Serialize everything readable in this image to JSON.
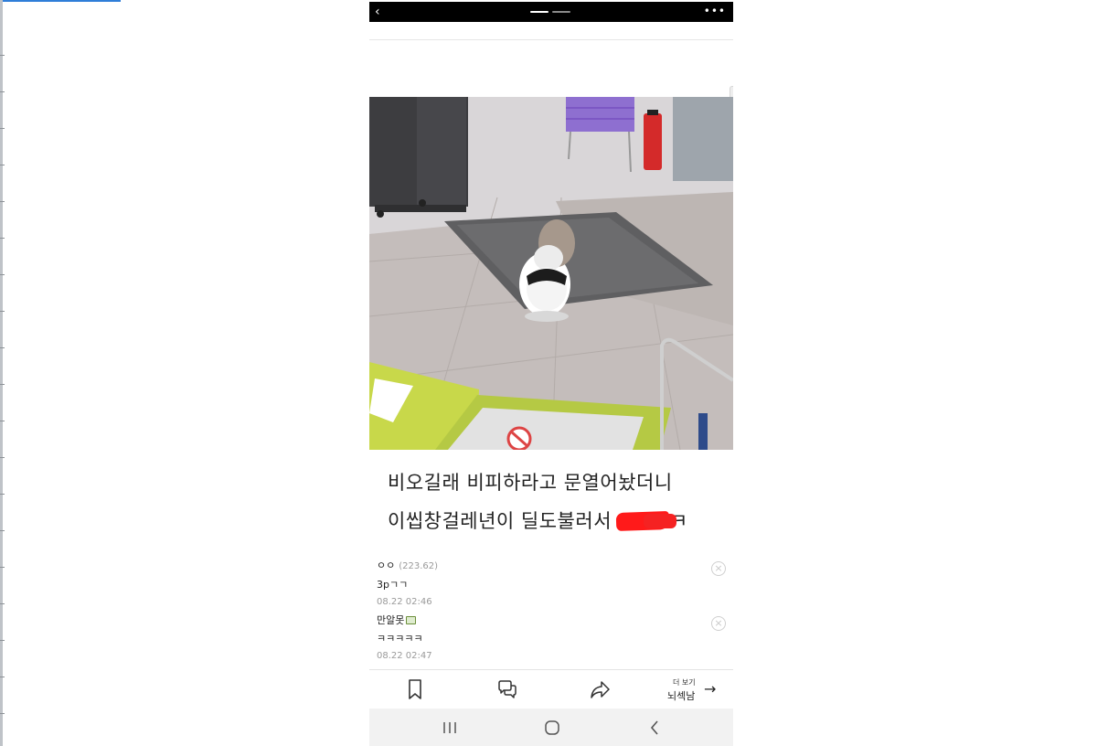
{
  "post": {
    "line1": "비오길래 비피하라고 문열어놨더니",
    "line2": "이씹창걸레년이 딜도불러서",
    "line2_end": "ㅋㅋ"
  },
  "comments": [
    {
      "author": "ㅇㅇ",
      "ip": "(223.62)",
      "text": "3pㄱㄱ",
      "time": "08.22 02:46"
    },
    {
      "author": "만알못",
      "text": "ㅋㅋㅋㅋㅋ",
      "time": "08.22 02:47"
    }
  ],
  "footer": {
    "more_small": "더 보기",
    "more_label": "뇌섹남"
  },
  "icons": {
    "back": "back-icon",
    "more": "more-icon",
    "bookmark": "bookmark-icon",
    "comment": "comment-icon",
    "share": "share-icon",
    "arrow": "arrow-right-icon",
    "delete": "delete-icon",
    "recents": "recent-apps-icon",
    "home": "home-icon",
    "nav_back": "nav-back-icon"
  },
  "colors": {
    "redaction": "#ff1a1a",
    "accent": "#2f7ed8"
  }
}
